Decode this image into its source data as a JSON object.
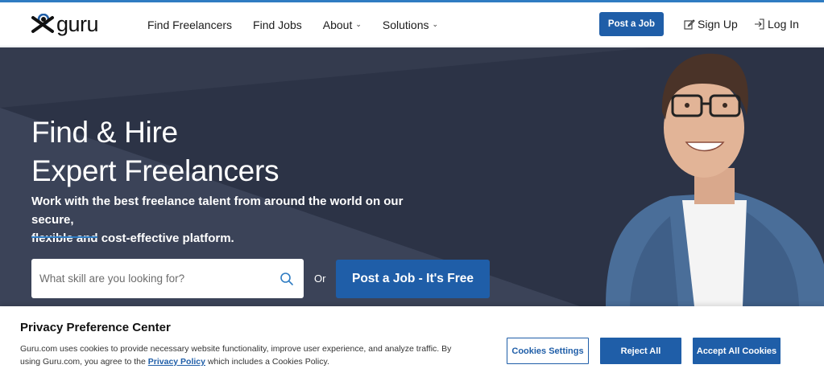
{
  "header": {
    "logo_text": "guru",
    "nav": [
      {
        "label": "Find Freelancers",
        "has_dropdown": false
      },
      {
        "label": "Find Jobs",
        "has_dropdown": false
      },
      {
        "label": "About",
        "has_dropdown": true
      },
      {
        "label": "Solutions",
        "has_dropdown": true
      }
    ],
    "post_job_label": "Post a Job",
    "signup_label": "Sign Up",
    "login_label": "Log In"
  },
  "hero": {
    "title_line1": "Find & Hire",
    "title_line2": "Expert Freelancers",
    "subtitle_line1": "Work with the best freelance talent from around the world on our secure,",
    "subtitle_line2": "flexible and cost-effective platform.",
    "search_placeholder": "What skill are you looking for?",
    "or_label": "Or",
    "post_job_label": "Post a Job - It's Free"
  },
  "privacy": {
    "title": "Privacy Preference Center",
    "text_before_link": "Guru.com uses cookies to provide necessary website functionality, improve user experience, and analyze traffic. By using Guru.com, you agree to the ",
    "link_label": "Privacy Policy",
    "text_after_link": " which includes a Cookies Policy.",
    "settings_label": "Cookies Settings",
    "reject_label": "Reject All",
    "accept_label": "Accept All Cookies"
  },
  "colors": {
    "brand_blue": "#1f5ea8",
    "hero_bg": "#3a4256",
    "accent_line": "#2f7cc2"
  },
  "icons": [
    "guru-logo-icon",
    "chevron-down-icon",
    "edit-icon",
    "login-icon",
    "search-icon"
  ]
}
